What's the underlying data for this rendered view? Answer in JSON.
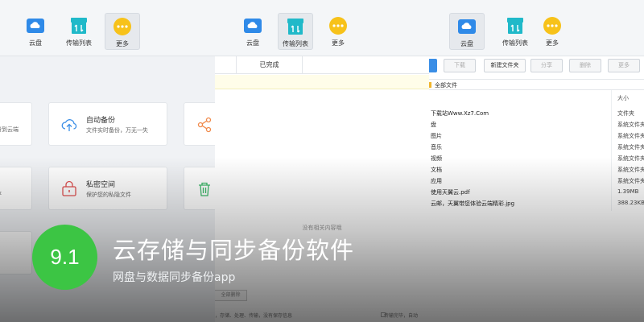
{
  "nav": {
    "cloud_label": "云盘",
    "transfer_label": "传输列表",
    "more_label": "更多"
  },
  "colors": {
    "cloud_icon": "#2f8ae8",
    "transfer_icon": "#20b9c9",
    "more_icon": "#f7c21a",
    "badge": "#3cc544",
    "toolbar_accent": "#3a8ee6"
  },
  "more_panel": {
    "backup_cut_desc": "份到云端",
    "auto_backup_title": "自动备份",
    "auto_backup_desc": "文件实时备份，万无一失",
    "private_cut_desc": "存",
    "private_space_title": "私密空间",
    "private_space_desc": "保护您的私隐文件",
    "icons": [
      "cloud-upload-icon",
      "share-icon",
      "lock-icon",
      "trash-icon"
    ]
  },
  "transfer_panel": {
    "completed_tab": "已完成",
    "empty_text": "没有相关内容哦",
    "clear_button": "全部删除",
    "hint_left": "，存储、处理、传输，没有保存信息",
    "hint_right": "传输完毕，自动"
  },
  "drive_panel": {
    "toolbar": {
      "download": "下载",
      "new_folder": "新建文件夹",
      "share": "分享",
      "delete": "删除",
      "more": "更多"
    },
    "path": "全部文件",
    "size_header": "大小",
    "files": [
      {
        "name": "下载站Www.Xz7.Com",
        "type": "文件夹"
      },
      {
        "name": "盘",
        "type": "系统文件夹"
      },
      {
        "name": "图片",
        "type": "系统文件夹"
      },
      {
        "name": "音乐",
        "type": "系统文件夹"
      },
      {
        "name": "视频",
        "type": "系统文件夹"
      },
      {
        "name": "文档",
        "type": "系统文件夹"
      },
      {
        "name": "应用",
        "type": "系统文件夹"
      },
      {
        "name": "使用天翼云.pdf",
        "type": "1.39MB"
      },
      {
        "name": "云邮，天翼带您体验云端精彩.jpg",
        "type": "388.23KB"
      }
    ]
  },
  "banner": {
    "badge": "9.1",
    "title": "云存储与同步备份软件",
    "subtitle": "网盘与数据同步备份app"
  }
}
